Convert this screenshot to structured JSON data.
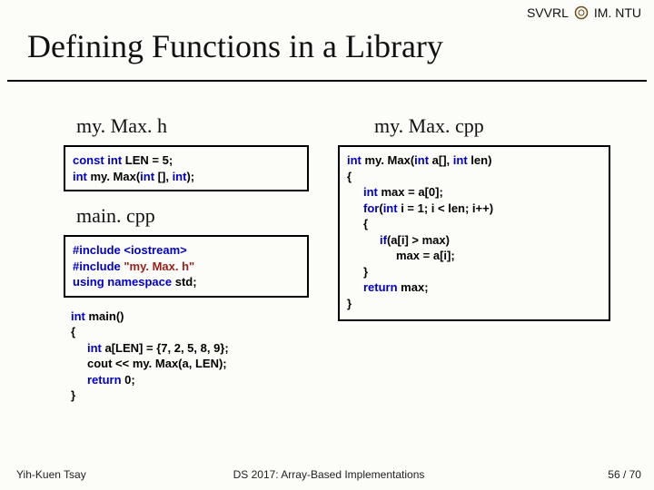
{
  "header": {
    "lab": "SVVRL",
    "dept": "IM. NTU"
  },
  "title": "Defining Functions in a Library",
  "left": {
    "h1": "my. Max. h",
    "box1": {
      "l1a": "const int ",
      "l1b": "LEN = 5;",
      "l2a": "int ",
      "l2b": "my. Max(",
      "l2c": "int ",
      "l2d": "[], ",
      "l2e": "int",
      "l2f": ");"
    },
    "h2": "main. cpp",
    "box2": {
      "l1": "#include <iostream>",
      "l2a": "#include ",
      "l2b": "\"my. Max. h\"",
      "l3a": "using namespace ",
      "l3b": "std;"
    },
    "free": {
      "l1a": "int ",
      "l1b": "main()",
      "l2": "{",
      "l3a": "int ",
      "l3b": "a[LEN] = {7, 2, 5, 8, 9};",
      "l4": "cout << my. Max(a, LEN);",
      "l5a": "return ",
      "l5b": "0;",
      "l6": "}"
    }
  },
  "right": {
    "h1": "my. Max. cpp",
    "box": {
      "l1a": "int ",
      "l1b": "my. Max(",
      "l1c": "int ",
      "l1d": "a[], ",
      "l1e": "int ",
      "l1f": "len)",
      "l2": "{",
      "l3a": "int ",
      "l3b": "max = a[0];",
      "l4a": "for",
      "l4b": "(",
      "l4c": "int ",
      "l4d": "i = 1; i < len; i++)",
      "l5": "{",
      "l6a": "if",
      "l6b": "(a[i] > max)",
      "l7": "max = a[i];",
      "l8": "}",
      "l9a": "return ",
      "l9b": "max;",
      "l10": "}"
    }
  },
  "footer": {
    "author": "Yih-Kuen Tsay",
    "course": "DS 2017: Array-Based Implementations",
    "page": "56 / 70"
  }
}
